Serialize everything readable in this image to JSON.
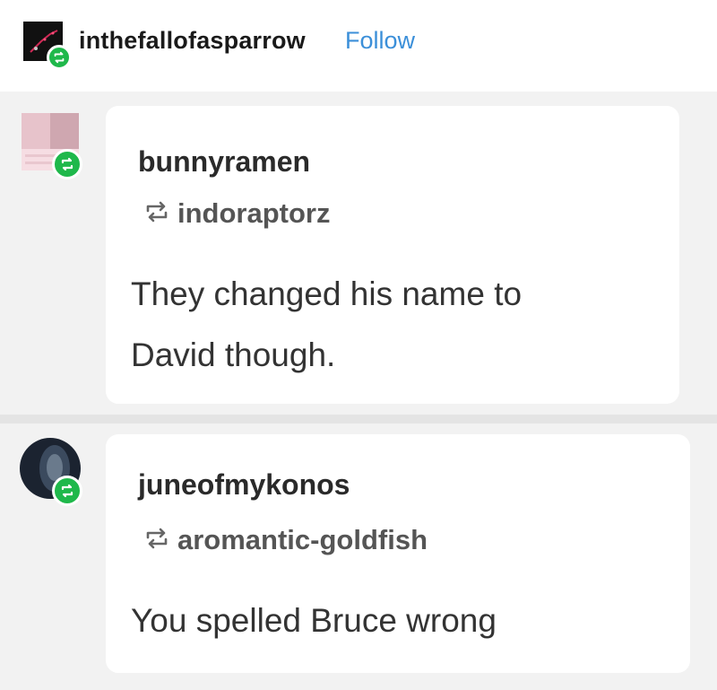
{
  "header": {
    "blog_name": "inthefallofasparrow",
    "follow_label": "Follow"
  },
  "posts": [
    {
      "username": "bunnyramen",
      "reblogged_from": "indoraptorz",
      "text_line1": "They changed his name to",
      "text_line2": "David though."
    },
    {
      "username": "juneofmykonos",
      "reblogged_from": "aromantic-goldfish",
      "text_line1": "You spelled Bruce wrong"
    }
  ],
  "colors": {
    "follow": "#3b8fd9",
    "reblog_badge": "#1fb84b",
    "background": "#f2f2f2"
  },
  "icons": [
    "reblog-icon",
    "reblog-badge-icon"
  ]
}
